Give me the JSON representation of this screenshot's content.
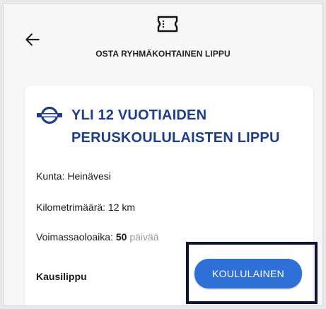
{
  "header": {
    "title": "OSTA RYHMÄKOHTAINEN LIPPU",
    "back_icon": "arrow-left-icon",
    "ticket_icon": "ticket-icon"
  },
  "card": {
    "title": "YLI 12 VUOTIAIDEN PERUSKOULULAISTEN LIPPU",
    "logo_icon": "transit-logo-icon",
    "rows": [
      {
        "label": "Kunta:",
        "value": "Heinävesi"
      },
      {
        "label": "Kilometrimäärä:",
        "value": "12 km"
      },
      {
        "label": "Voimassaoloaika:",
        "value": "50",
        "suffix": "päivää"
      }
    ],
    "ticket_type": "Kausilippu",
    "action_button": "KOULULAINEN"
  },
  "colors": {
    "accent": "#2f6fd8",
    "title": "#1f3c8f",
    "highlight": "#0e1533"
  }
}
